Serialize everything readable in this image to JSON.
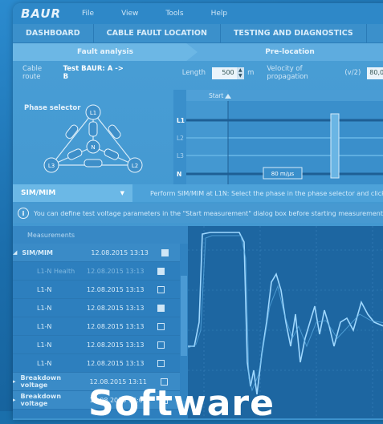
{
  "brand": {
    "logo": "BAUR"
  },
  "menu": [
    "File",
    "View",
    "Tools",
    "Help"
  ],
  "nav_tabs": [
    "DASHBOARD",
    "CABLE FAULT LOCATION",
    "TESTING AND DIAGNOSTICS"
  ],
  "steps": [
    "Fault analysis",
    "Pre-location"
  ],
  "params": {
    "cable_route_label": "Cable route",
    "cable_route_value": "Test BAUR: A -> B",
    "length_label": "Length",
    "length_value": "500",
    "length_unit": "m",
    "velocity_label": "Velocity of propagation",
    "velocity_suffix": "(v/2)",
    "velocity_value": "80,0"
  },
  "phase_selector": {
    "label": "Phase selector",
    "nodes": [
      "L1",
      "L2",
      "L3",
      "N"
    ]
  },
  "trace": {
    "start_label": "Start",
    "phase_rows": [
      "L1",
      "L2",
      "L3",
      "N"
    ],
    "velocity_marker": "80 m/µs"
  },
  "sim": {
    "selected": "SIM/MIM",
    "message": "Perform SIM/MIM at L1N: Select the phase in the phase selector and click \""
  },
  "info": {
    "text": "You can define test voltage parameters in the \"Start measurement\" dialog box before starting measurement."
  },
  "measurements": {
    "header": "Measurements",
    "rows": [
      {
        "name": "SIM/MIM",
        "date": "12.08.2015 13:13",
        "group": true,
        "checked": true,
        "dim": false
      },
      {
        "name": "L1-N Health",
        "date": "12.08.2015 13:13",
        "group": false,
        "checked": true,
        "dim": true
      },
      {
        "name": "L1-N",
        "date": "12.08.2015 13:13",
        "group": false,
        "checked": false,
        "dim": false
      },
      {
        "name": "L1-N",
        "date": "12.08.2015 13:13",
        "group": false,
        "checked": true,
        "dim": false
      },
      {
        "name": "L1-N",
        "date": "12.08.2015 13:13",
        "group": false,
        "checked": false,
        "dim": false
      },
      {
        "name": "L1-N",
        "date": "12.08.2015 13:13",
        "group": false,
        "checked": false,
        "dim": false
      },
      {
        "name": "L1-N",
        "date": "12.08.2015 13:13",
        "group": false,
        "checked": false,
        "dim": false
      },
      {
        "name": "Breakdown voltage",
        "date": "12.08.2015 13:11",
        "group": true,
        "checked": false,
        "dim": false
      },
      {
        "name": "Breakdown voltage",
        "date": "12.08.2015 13:09",
        "group": true,
        "checked": false,
        "dim": false
      }
    ]
  },
  "headline": "Software",
  "colors": {
    "background": "#1b6eac",
    "panel": "#3d92cc",
    "trace_line": "#9fd8ff"
  }
}
